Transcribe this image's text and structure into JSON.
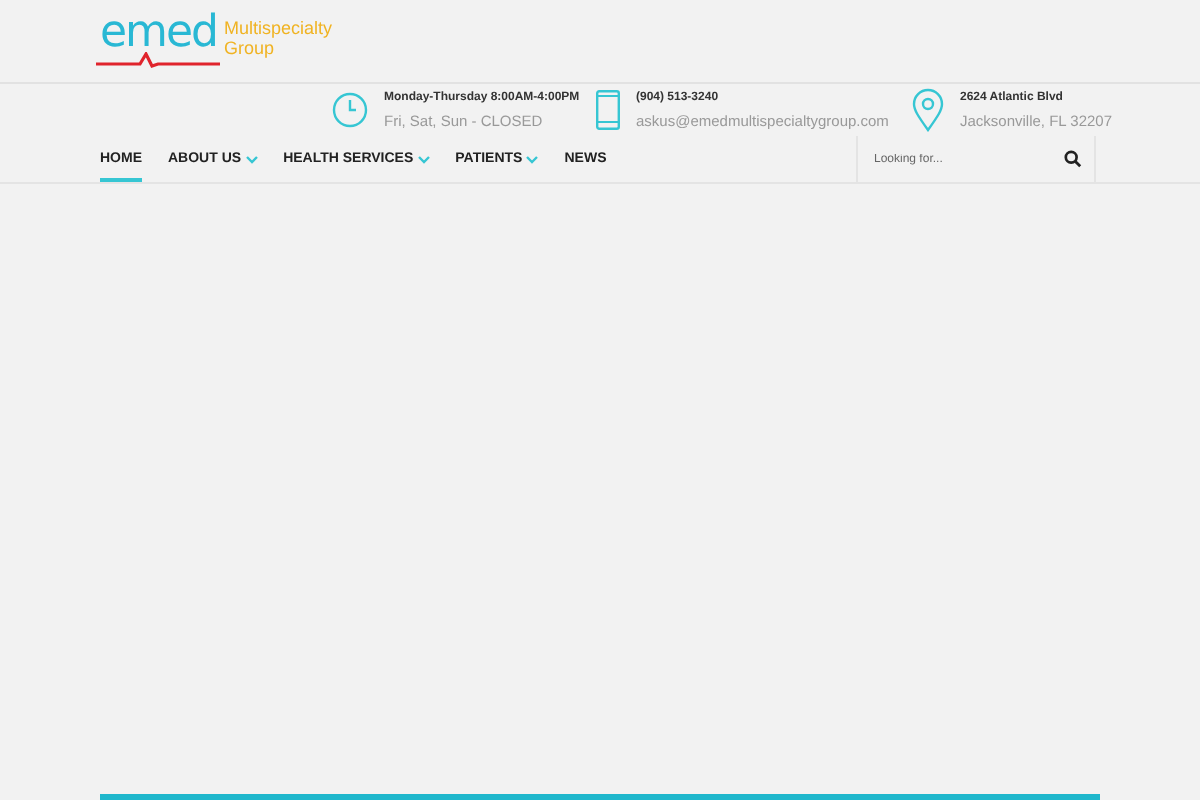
{
  "logo": {
    "mark": "emed",
    "tagline_1": "Multispecialty",
    "tagline_2": "Group"
  },
  "info": [
    {
      "kind": "clock",
      "line_1": "Monday-Thursday 8:00AM-4:00PM",
      "line_2": "Fri, Sat, Sun - CLOSED"
    },
    {
      "kind": "phone",
      "line_1": "(904) 513-3240",
      "line_2": "askus@emedmultispecialtygroup.com"
    },
    {
      "kind": "pin",
      "line_1": "2624 Atlantic Blvd",
      "line_2": "Jacksonville, FL 32207"
    }
  ],
  "nav": [
    {
      "label": "HOME",
      "selected": true,
      "has_dropdown": false
    },
    {
      "label": "ABOUT US",
      "selected": false,
      "has_dropdown": true
    },
    {
      "label": "HEALTH SERVICES",
      "selected": false,
      "has_dropdown": true
    },
    {
      "label": "PATIENTS",
      "selected": false,
      "has_dropdown": true
    },
    {
      "label": "NEWS",
      "selected": false,
      "has_dropdown": false
    }
  ],
  "search": {
    "placeholder": "Looking for..."
  }
}
